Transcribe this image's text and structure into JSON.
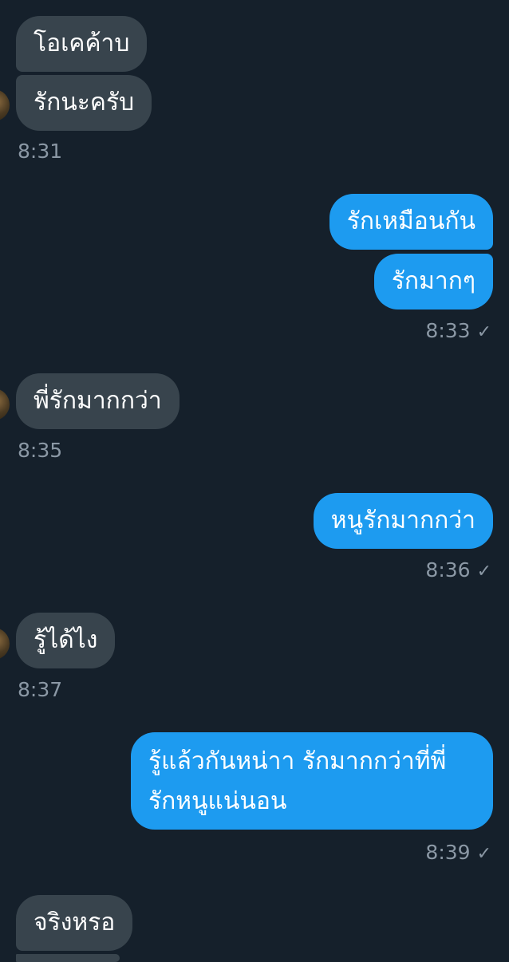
{
  "chat": {
    "m1": "โอเคค้าบ",
    "m2": "รักนะครับ",
    "t1": "8:31",
    "m3": "รักเหมือนกัน",
    "m4": "รักมากๆ",
    "t2": "8:33",
    "m5": "พี่รักมากกว่า",
    "t3": "8:35",
    "m6": "หนูรักมากกว่า",
    "t4": "8:36",
    "m7": "รู้ได้ไง",
    "t5": "8:37",
    "m8_line1": "รู้แล้วกันหน่าา รักมากกว่าที่พี่",
    "m8_line2": "รักหนูแน่นอน",
    "t6": "8:39",
    "m9": "จริงหรอ",
    "check_icon": "✓"
  },
  "colors": {
    "background": "#15202b",
    "incoming_bubble": "#38444d",
    "outgoing_bubble": "#1d9bf0",
    "timestamp": "#8b98a5"
  }
}
